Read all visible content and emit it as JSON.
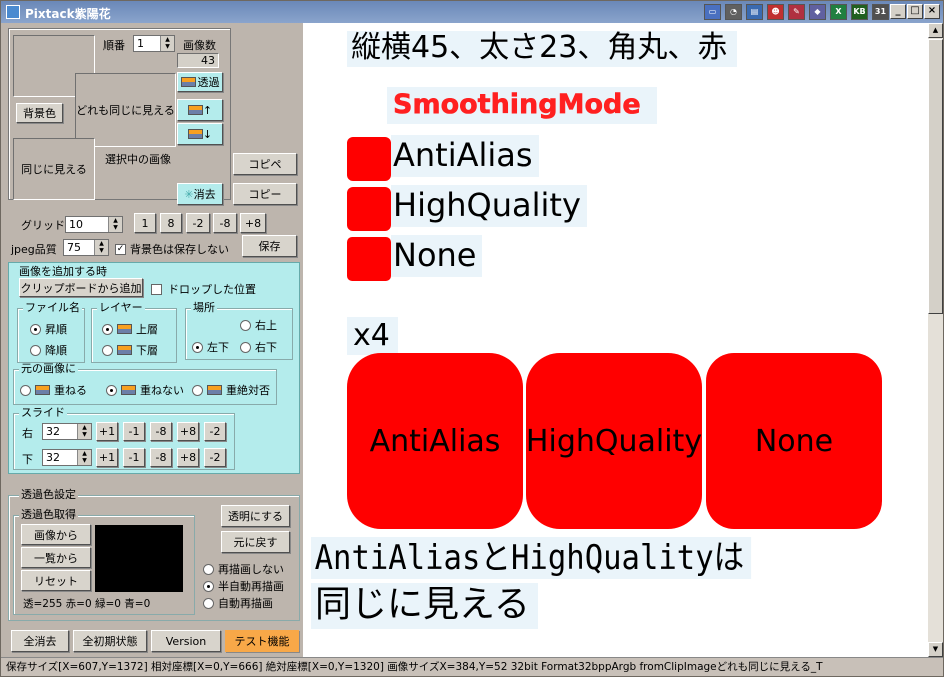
{
  "window": {
    "title": "Pixtack紫陽花",
    "tray_icons": [
      "monitor-icon",
      "clock-icon",
      "network-icon",
      "character-icon",
      "pen-icon",
      "app-icon",
      "excel-icon",
      "kb-icon",
      "calc-icon"
    ],
    "tray_labels": {
      "excel": "X",
      "kb": "KB",
      "calc": "31"
    }
  },
  "top": {
    "order_label": "順番",
    "order_value": "1",
    "count_label": "画像数",
    "count_value": "43",
    "bg_color_button": "背景色",
    "same_preview_label": "どれも同じに見える",
    "same_label": "同じに見える",
    "selected_label": "選択中の画像",
    "transparent_button": "透過",
    "copy_paste_button": "コピペ",
    "copy_button": "コピー",
    "clear_button": "消去"
  },
  "grid": {
    "label": "グリッド",
    "value": "10",
    "steps": [
      "1",
      "8",
      "-2",
      "-8",
      "+8"
    ]
  },
  "jpeg": {
    "label": "jpeg品質",
    "value": "75",
    "dont_save_bg": "背景色は保存しない",
    "save_button": "保存"
  },
  "add": {
    "title": "画像を追加する時",
    "clipboard_button": "クリップボードから追加",
    "drop_pos": "ドロップした位置",
    "filename": {
      "title": "ファイル名",
      "asc": "昇順",
      "desc": "降順"
    },
    "layer": {
      "title": "レイヤー",
      "upper": "上層",
      "lower": "下層"
    },
    "place": {
      "title": "場所",
      "top_right": "右上",
      "bottom_left": "左下",
      "bottom_right": "右下"
    },
    "orig": {
      "title": "元の画像に",
      "overlap": "重ねる",
      "no_overlap": "重ねない",
      "never": "重絶対否"
    },
    "slide": {
      "title": "スライド",
      "right": "右",
      "down": "下",
      "right_value": "32",
      "down_value": "32",
      "steps": [
        "+1",
        "-1",
        "-8",
        "+8",
        "-2"
      ]
    }
  },
  "trans": {
    "title": "透過色設定",
    "get_title": "透過色取得",
    "from_image": "画像から",
    "from_list": "一覧から",
    "reset": "リセット",
    "make_transparent": "透明にする",
    "restore": "元に戻す",
    "no_redraw": "再描画しない",
    "semi_auto": "半自動再描画",
    "auto": "自動再描画",
    "info": "透=255 赤=0 緑=0 青=0"
  },
  "tabs": [
    "全消去",
    "全初期状態",
    "Version",
    "テスト機能"
  ],
  "canvas": {
    "heading": "縦横45、太さ23、角丸、赤",
    "smoothing": "SmoothingMode",
    "modes": [
      "AntiAlias",
      "HighQuality",
      "None"
    ],
    "x4": "x4",
    "conclusion_line1": "AntiAliasとHighQualityは",
    "conclusion_line2": "同じに見える",
    "colors": {
      "red": "#ff0000",
      "smoothing_text": "#ff2020"
    }
  },
  "status": "保存サイズ[X=607,Y=1372] 相対座標[X=0,Y=666] 絶対座標[X=0,Y=1320] 画像サイズX=384,Y=52 32bit Format32bppArgb fromClipImageどれも同じに見える_T"
}
